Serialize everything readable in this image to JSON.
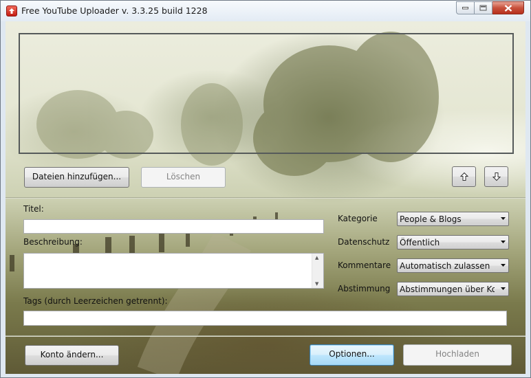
{
  "window": {
    "title": "Free YouTube Uploader  v. 3.3.25 build 1228"
  },
  "toolbar": {
    "add_files_label": "Dateien hinzufügen...",
    "delete_label": "Löschen"
  },
  "form": {
    "title_label": "Titel:",
    "title_value": "",
    "description_label": "Beschreibung:",
    "description_value": "",
    "tags_label": "Tags (durch Leerzeichen getrennt):",
    "tags_value": ""
  },
  "settings": {
    "category_label": "Kategorie",
    "category_value": "People & Blogs",
    "privacy_label": "Datenschutz",
    "privacy_value": "Öffentlich",
    "comments_label": "Kommentare",
    "comments_value": "Automatisch zulassen",
    "rating_label": "Abstimmung",
    "rating_value": "Abstimmungen über Kom"
  },
  "footer": {
    "change_account_label": "Konto ändern...",
    "options_label": "Optionen...",
    "upload_label": "Hochladen"
  },
  "icons": {
    "app": "youtube-upload-icon",
    "move_up": "arrow-up-icon",
    "move_down": "arrow-down-icon"
  }
}
